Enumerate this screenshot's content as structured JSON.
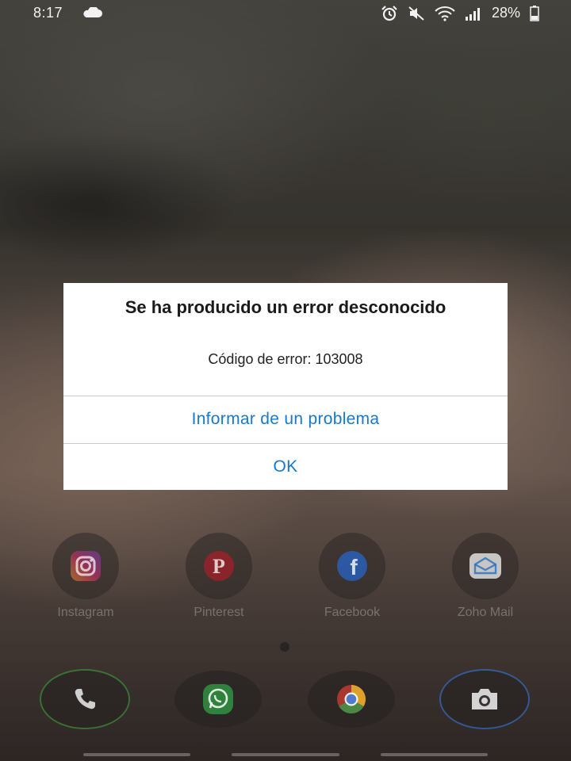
{
  "status_bar": {
    "time": "8:17",
    "battery_percent": "28%",
    "icons": [
      "cloud-icon",
      "alarm-icon",
      "mute-icon",
      "wifi-icon",
      "signal-icon",
      "battery-icon"
    ]
  },
  "dialog": {
    "title": "Se ha producido un error desconocido",
    "message": "Código de error: 103008",
    "report_button": "Informar de un problema",
    "ok_button": "OK",
    "button_color": "#1a78c9"
  },
  "home_apps": [
    {
      "label": "Instagram",
      "icon": "instagram-icon"
    },
    {
      "label": "Pinterest",
      "icon": "pinterest-icon"
    },
    {
      "label": "Facebook",
      "icon": "facebook-icon"
    },
    {
      "label": "Zoho Mail",
      "icon": "zoho-mail-icon"
    }
  ],
  "dock_apps": [
    {
      "icon": "phone-icon"
    },
    {
      "icon": "whatsapp-icon"
    },
    {
      "icon": "chrome-icon"
    },
    {
      "icon": "camera-icon"
    }
  ]
}
